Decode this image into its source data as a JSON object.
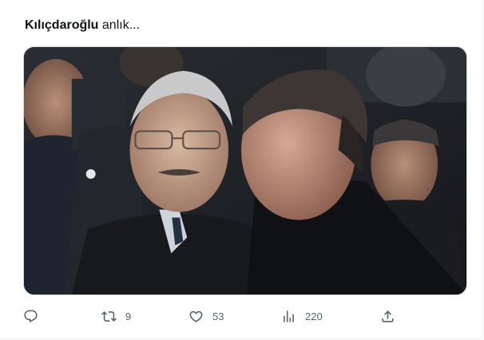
{
  "tweet": {
    "author_mention": "Kılıçdaroğlu",
    "text_rest": " anlık...",
    "media_alt": "Photo of two men at a ceremony"
  },
  "actions": {
    "reply": {
      "icon": "reply-icon",
      "count": ""
    },
    "retweet": {
      "icon": "retweet-icon",
      "count": "9"
    },
    "like": {
      "icon": "heart-icon",
      "count": "53"
    },
    "views": {
      "icon": "views-chart-icon",
      "count": "220"
    },
    "share": {
      "icon": "share-icon",
      "count": ""
    }
  },
  "colors": {
    "text": "#0f1419",
    "muted": "#536471",
    "border": "#cfd9de"
  }
}
